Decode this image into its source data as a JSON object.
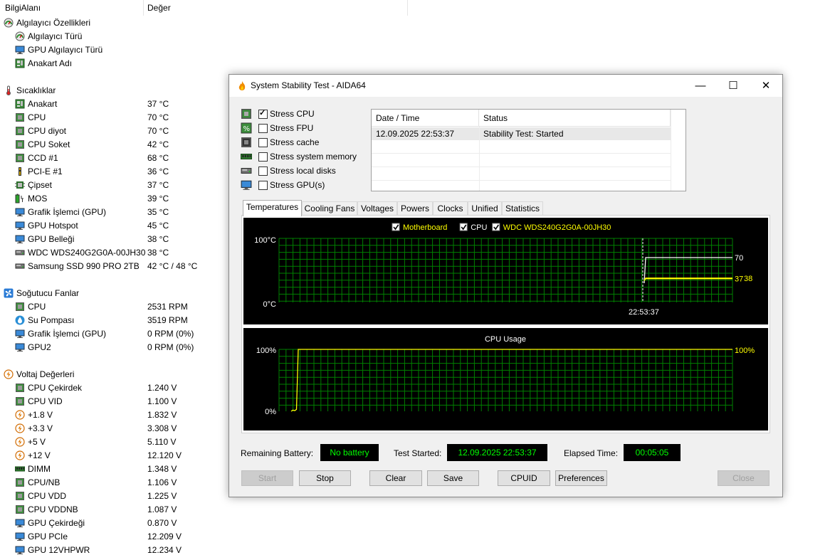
{
  "sensor_panel": {
    "col_field": "BilgiAlanı",
    "col_value": "Değer",
    "rows": [
      {
        "kind": "cat",
        "icon": "sensor-icon",
        "label": "Algılayıcı Özellikleri",
        "value": ""
      },
      {
        "kind": "item",
        "icon": "sensor-icon",
        "label": "Algılayıcı Türü",
        "value": ""
      },
      {
        "kind": "item",
        "icon": "monitor-icon",
        "label": "GPU Algılayıcı Türü",
        "value": ""
      },
      {
        "kind": "item",
        "icon": "motherboard-icon",
        "label": "Anakart Adı",
        "value": ""
      },
      {
        "kind": "gap"
      },
      {
        "kind": "cat",
        "icon": "thermometer-icon",
        "label": "Sıcaklıklar",
        "value": ""
      },
      {
        "kind": "item",
        "icon": "motherboard-icon",
        "label": "Anakart",
        "value": "37 °C"
      },
      {
        "kind": "item",
        "icon": "chip-icon",
        "label": "CPU",
        "value": "70 °C"
      },
      {
        "kind": "item",
        "icon": "chip-icon",
        "label": "CPU diyot",
        "value": "70 °C"
      },
      {
        "kind": "item",
        "icon": "chip-icon",
        "label": "CPU Soket",
        "value": "42 °C"
      },
      {
        "kind": "item",
        "icon": "chip-icon",
        "label": "CCD #1",
        "value": "68 °C"
      },
      {
        "kind": "item",
        "icon": "pcie-icon",
        "label": "PCI-E #1",
        "value": "36 °C"
      },
      {
        "kind": "item",
        "icon": "chipset-icon",
        "label": "Çipset",
        "value": "37 °C"
      },
      {
        "kind": "item",
        "icon": "battery-icon",
        "label": "MOS",
        "value": "39 °C"
      },
      {
        "kind": "item",
        "icon": "monitor-icon",
        "label": "Grafik İşlemci (GPU)",
        "value": "35 °C"
      },
      {
        "kind": "item",
        "icon": "monitor-icon",
        "label": "GPU Hotspot",
        "value": "45 °C"
      },
      {
        "kind": "item",
        "icon": "monitor-icon",
        "label": "GPU Belleği",
        "value": "38 °C"
      },
      {
        "kind": "item",
        "icon": "disk-icon",
        "label": "WDC WDS240G2G0A-00JH30",
        "value": "38 °C"
      },
      {
        "kind": "item",
        "icon": "disk-icon",
        "label": "Samsung SSD 990 PRO 2TB",
        "value": "42 °C / 48 °C"
      },
      {
        "kind": "gap"
      },
      {
        "kind": "cat",
        "icon": "fan-icon",
        "label": "Soğutucu Fanlar",
        "value": ""
      },
      {
        "kind": "item",
        "icon": "chip-icon",
        "label": "CPU",
        "value": "2531 RPM"
      },
      {
        "kind": "item",
        "icon": "water-drop-icon",
        "label": "Su Pompası",
        "value": "3519 RPM"
      },
      {
        "kind": "item",
        "icon": "monitor-icon",
        "label": "Grafik İşlemci (GPU)",
        "value": "0 RPM  (0%)"
      },
      {
        "kind": "item",
        "icon": "monitor-icon",
        "label": "GPU2",
        "value": "0 RPM  (0%)"
      },
      {
        "kind": "gap"
      },
      {
        "kind": "cat",
        "icon": "voltage-icon",
        "label": "Voltaj Değerleri",
        "value": ""
      },
      {
        "kind": "item",
        "icon": "chip-icon",
        "label": "CPU Çekirdek",
        "value": "1.240 V"
      },
      {
        "kind": "item",
        "icon": "chip-icon",
        "label": "CPU VID",
        "value": "1.100 V"
      },
      {
        "kind": "item",
        "icon": "voltage-icon",
        "label": "+1.8 V",
        "value": "1.832 V"
      },
      {
        "kind": "item",
        "icon": "voltage-icon",
        "label": "+3.3 V",
        "value": "3.308 V"
      },
      {
        "kind": "item",
        "icon": "voltage-icon",
        "label": "+5 V",
        "value": "5.110 V"
      },
      {
        "kind": "item",
        "icon": "voltage-icon",
        "label": "+12 V",
        "value": "12.120 V"
      },
      {
        "kind": "item",
        "icon": "memory-icon",
        "label": "DIMM",
        "value": "1.348 V"
      },
      {
        "kind": "item",
        "icon": "chip-icon",
        "label": "CPU/NB",
        "value": "1.106 V"
      },
      {
        "kind": "item",
        "icon": "chip-icon",
        "label": "CPU VDD",
        "value": "1.225 V"
      },
      {
        "kind": "item",
        "icon": "chip-icon",
        "label": "CPU VDDNB",
        "value": "1.087 V"
      },
      {
        "kind": "item",
        "icon": "monitor-icon",
        "label": "GPU Çekirdeği",
        "value": "0.870 V"
      },
      {
        "kind": "item",
        "icon": "monitor-icon",
        "label": "GPU PCIe",
        "value": "12.209 V"
      },
      {
        "kind": "item",
        "icon": "monitor-icon",
        "label": "GPU 12VHPWR",
        "value": "12.234 V"
      }
    ]
  },
  "dialog": {
    "title": "System Stability Test - AIDA64",
    "window_buttons": {
      "minimize": "—",
      "maximize": "☐",
      "close": "✕"
    },
    "stress_options": [
      {
        "icon": "cpu-chip-icon",
        "label": "Stress CPU",
        "checked": true
      },
      {
        "icon": "fpu-icon",
        "label": "Stress FPU",
        "checked": false
      },
      {
        "icon": "cache-icon",
        "label": "Stress cache",
        "checked": false
      },
      {
        "icon": "memory-icon",
        "label": "Stress system memory",
        "checked": false
      },
      {
        "icon": "disk-icon",
        "label": "Stress local disks",
        "checked": false
      },
      {
        "icon": "monitor-icon",
        "label": "Stress GPU(s)",
        "checked": false
      }
    ],
    "status_table": {
      "headers": [
        "Date / Time",
        "Status"
      ],
      "rows": [
        [
          "12.09.2025 22:53:37",
          "Stability Test: Started"
        ]
      ]
    },
    "tabs": [
      "Temperatures",
      "Cooling Fans",
      "Voltages",
      "Powers",
      "Clocks",
      "Unified",
      "Statistics"
    ],
    "active_tab": "Temperatures",
    "bottom": {
      "battery_label": "Remaining Battery:",
      "battery_value": "No battery",
      "started_label": "Test Started:",
      "started_value": "12.09.2025 22:53:37",
      "elapsed_label": "Elapsed Time:",
      "elapsed_value": "00:05:05"
    },
    "buttons": {
      "start": "Start",
      "stop": "Stop",
      "clear": "Clear",
      "save": "Save",
      "cpuid": "CPUID",
      "preferences": "Preferences",
      "close": "Close"
    }
  },
  "chart_data": [
    {
      "type": "line",
      "title": "",
      "legend": [
        {
          "name": "Motherboard",
          "checked": true,
          "color": "#ffff00"
        },
        {
          "name": "CPU",
          "checked": true,
          "color": "#ffffff"
        },
        {
          "name": "WDC WDS240G2G0A-00JH30",
          "checked": true,
          "color": "#ffff00"
        }
      ],
      "ylim": [
        0,
        100
      ],
      "y_tick_labels": [
        "100°C",
        "0°C"
      ],
      "x_marker_label": "22:53:37",
      "series": [
        {
          "name": "CPU",
          "color": "#ffffff",
          "start_value": 30,
          "values": [
            70,
            70,
            70,
            70,
            70,
            70,
            70,
            70,
            70,
            70,
            70
          ],
          "end_label": "70"
        },
        {
          "name": "Motherboard",
          "color": "#ffff00",
          "start_value": 34,
          "values": [
            37,
            37,
            37,
            37,
            37,
            37,
            37,
            37,
            37,
            37,
            37
          ],
          "end_label": "37"
        },
        {
          "name": "WDC WDS240G2G0A-00JH30",
          "color": "#ffff00",
          "start_value": 34,
          "values": [
            38,
            38,
            38,
            38,
            38,
            38,
            38,
            38,
            38,
            38,
            38
          ],
          "end_label": "38"
        }
      ]
    },
    {
      "type": "line",
      "title": "CPU Usage",
      "ylim": [
        0,
        100
      ],
      "y_tick_labels": [
        "100%",
        "0%"
      ],
      "series": [
        {
          "name": "CPU Usage",
          "color": "#ffff00",
          "values": [
            0,
            2,
            1,
            3,
            100,
            100,
            100,
            100,
            100,
            100,
            100,
            100,
            100,
            100,
            100,
            100,
            100,
            100,
            100,
            100,
            100,
            100,
            100,
            100,
            100,
            100,
            100,
            100,
            100,
            100,
            100,
            100,
            100,
            100,
            100,
            100,
            100,
            100,
            100,
            100
          ],
          "end_label": "100%"
        }
      ]
    }
  ],
  "colors": {
    "grid": "#008000",
    "graph_bg": "#000000",
    "accent_text": "#00ff00"
  }
}
